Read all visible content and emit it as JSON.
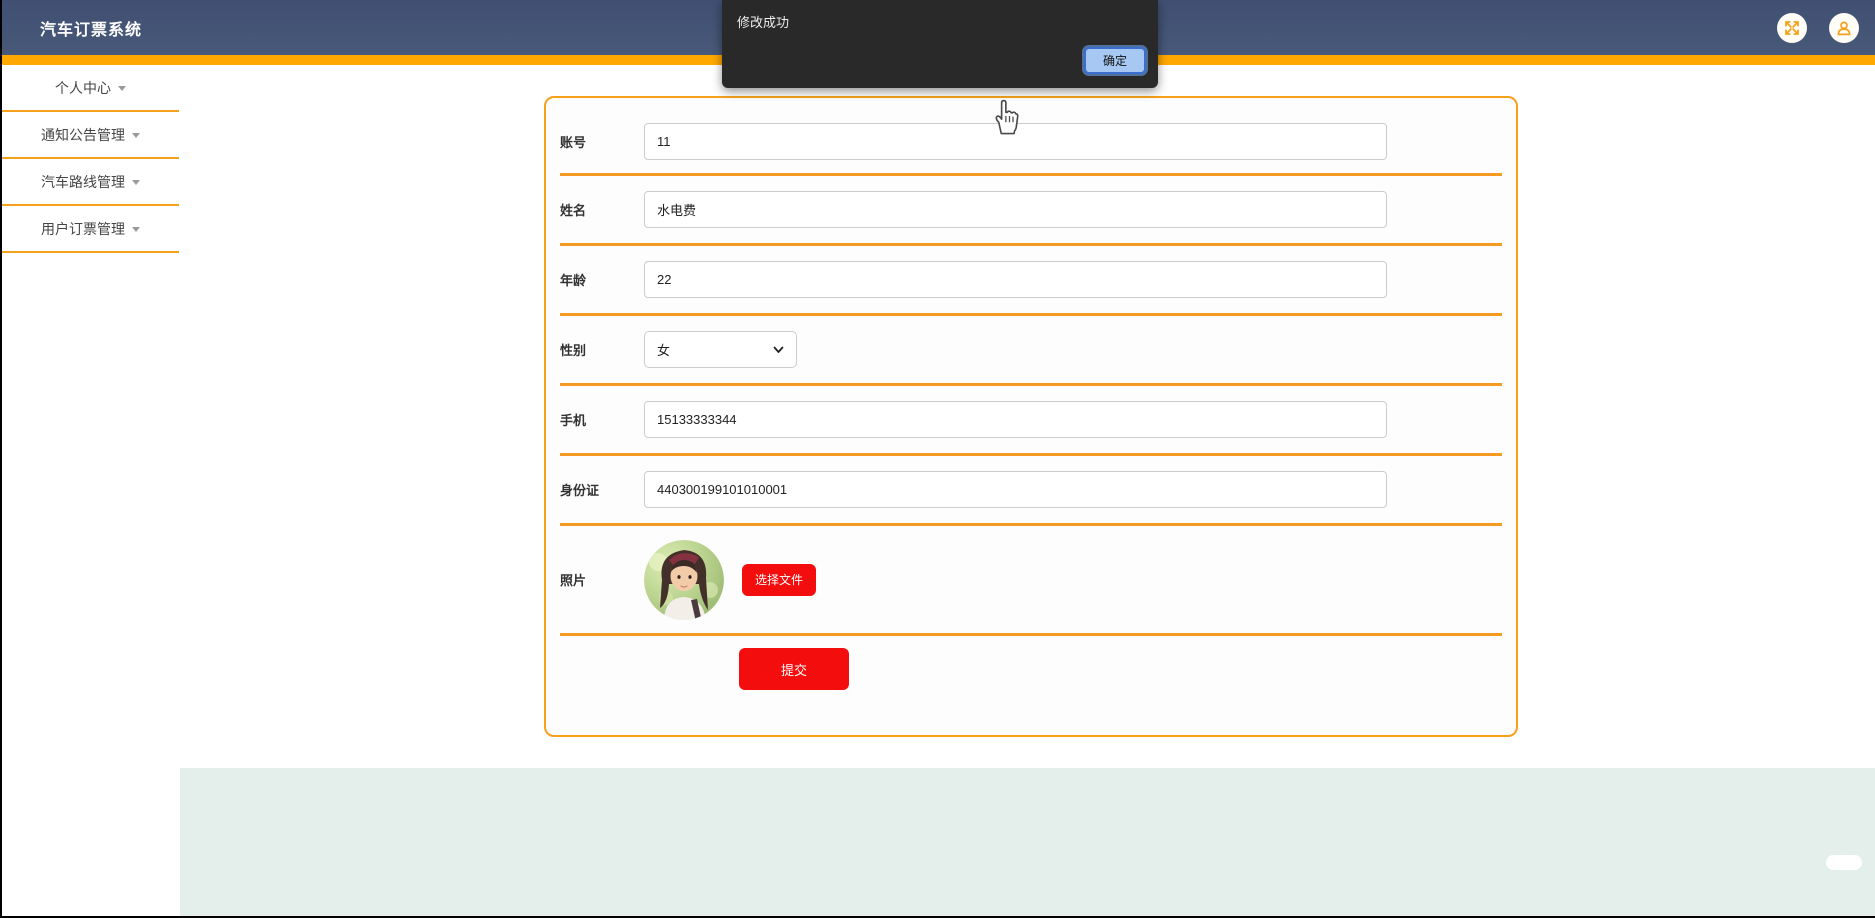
{
  "app": {
    "title": "汽车订票系统"
  },
  "header": {
    "icons": [
      {
        "name": "fullscreen-icon"
      },
      {
        "name": "user-icon"
      }
    ]
  },
  "dialog": {
    "message": "修改成功",
    "ok_label": "确定"
  },
  "sidebar": {
    "items": [
      {
        "label": "个人中心"
      },
      {
        "label": "通知公告管理"
      },
      {
        "label": "汽车路线管理"
      },
      {
        "label": "用户订票管理"
      }
    ]
  },
  "form": {
    "fields": [
      {
        "label": "账号",
        "value": "11",
        "type": "input"
      },
      {
        "label": "姓名",
        "value": "水电费",
        "type": "input"
      },
      {
        "label": "年龄",
        "value": "22",
        "type": "input"
      },
      {
        "label": "性别",
        "value": "女",
        "type": "select"
      },
      {
        "label": "手机",
        "value": "15133333344",
        "type": "input"
      },
      {
        "label": "身份证",
        "value": "440300199101010001",
        "type": "input"
      },
      {
        "label": "照片",
        "type": "file",
        "button_label": "选择文件"
      }
    ],
    "submit_label": "提交"
  },
  "colors": {
    "navbar": "#45567b",
    "accent_strip": "#ffa800",
    "accent_line": "#f59a23",
    "danger_button": "#f30d0d",
    "footer": "#e4efeb",
    "dialog_bg": "#292929",
    "ok_button_bg": "#a6c8f2",
    "ok_button_border": "#3a6fd0"
  }
}
